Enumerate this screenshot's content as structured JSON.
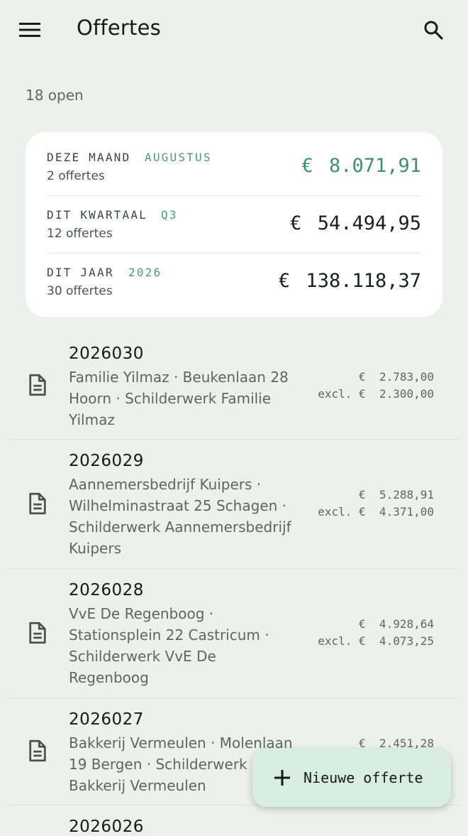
{
  "appbar": {
    "title": "Offertes",
    "menu_icon": "menu-icon",
    "search_icon": "search-icon"
  },
  "subtitle": "18 open",
  "summary": {
    "accent_color": "#4e9a78",
    "rows": [
      {
        "label": "DEZE MAAND",
        "tag": "AUGUSTUS",
        "count": "2 offertes",
        "amount": "€ 8.071,91",
        "highlight": true
      },
      {
        "label": "DIT KWARTAAL",
        "tag": "Q3",
        "count": "12 offertes",
        "amount": "€ 54.494,95",
        "highlight": false
      },
      {
        "label": "DIT JAAR",
        "tag": "2026",
        "count": "30 offertes",
        "amount": "€ 138.118,37",
        "highlight": false
      }
    ]
  },
  "quotes": [
    {
      "number": "2026030",
      "description": "Familie Yilmaz · Beukenlaan 28 Hoorn · Schilderwerk Familie Yilmaz",
      "incl": "€  2.783,00",
      "excl": "excl. €  2.300,00",
      "icon": "document-icon"
    },
    {
      "number": "2026029",
      "description": "Aannemersbedrijf Kuipers · Wilhelminastraat 25 Schagen · Schilderwerk Aannemersbedrijf Kuipers",
      "incl": "€  5.288,91",
      "excl": "excl. €  4.371,00",
      "icon": "document-icon"
    },
    {
      "number": "2026028",
      "description": "VvE De Regenboog · Stationsplein 22 Castricum · Schilderwerk VvE De Regenboog",
      "incl": "€  4.928,64",
      "excl": "excl. €  4.073,25",
      "icon": "document-icon"
    },
    {
      "number": "2026027",
      "description": "Bakkerij Vermeulen · Molenlaan 19 Bergen · Schilderwerk Bakkerij Vermeulen",
      "incl": "€  2.451,28",
      "excl": "",
      "icon": "document-icon"
    },
    {
      "number": "2026026",
      "description": "",
      "incl": "",
      "excl": "",
      "icon": "document-icon"
    }
  ],
  "fab": {
    "label": "Nieuwe offerte",
    "icon": "plus-icon"
  }
}
